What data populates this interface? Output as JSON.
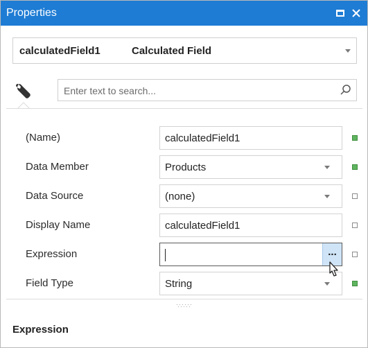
{
  "window": {
    "title": "Properties"
  },
  "selector": {
    "object_name": "calculatedField1",
    "object_type": "Calculated Field"
  },
  "search": {
    "placeholder": "Enter text to search..."
  },
  "properties": [
    {
      "label": "(Name)",
      "value": "calculatedField1",
      "editor": "text",
      "marker": "filled"
    },
    {
      "label": "Data Member",
      "value": "Products",
      "editor": "dropdown",
      "marker": "filled"
    },
    {
      "label": "Data Source",
      "value": "(none)",
      "editor": "dropdown",
      "marker": "empty"
    },
    {
      "label": "Display Name",
      "value": "calculatedField1",
      "editor": "text",
      "marker": "empty"
    },
    {
      "label": "Expression",
      "value": "",
      "editor": "ellipsis",
      "marker": "empty"
    },
    {
      "label": "Field Type",
      "value": "String",
      "editor": "dropdown",
      "marker": "filled"
    }
  ],
  "expression_button_label": "...",
  "help": {
    "title": "Expression"
  },
  "colors": {
    "title_bar": "#1e7cd4",
    "marker_filled": "#5fb45f",
    "ellipsis_button": "#cfe4f7"
  }
}
